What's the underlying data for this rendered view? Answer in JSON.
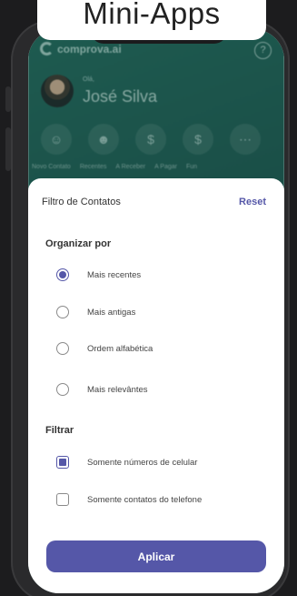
{
  "banner": {
    "title": "Mini-Apps"
  },
  "app": {
    "brand": "comprova.ai",
    "user_greeting": "Olá,",
    "user_name": "José Silva",
    "shortcuts": [
      {
        "icon": "user-icon",
        "label": "Novo Contato"
      },
      {
        "icon": "users-icon",
        "label": "Recentes"
      },
      {
        "icon": "receive-icon",
        "label": "A Receber"
      },
      {
        "icon": "pay-icon",
        "label": "A Pagar"
      },
      {
        "icon": "more-icon",
        "label": "Fun"
      }
    ]
  },
  "sheet": {
    "title": "Filtro de Contatos",
    "reset_label": "Reset",
    "sort_title": "Organizar por",
    "sort_options": [
      {
        "label": "Mais recentes",
        "checked": true
      },
      {
        "label": "Mais antigas",
        "checked": false
      },
      {
        "label": "Ordem alfabética",
        "checked": false
      },
      {
        "label": "Mais relevântes",
        "checked": false
      }
    ],
    "filter_title": "Filtrar",
    "filter_options": [
      {
        "label": "Somente números de celular",
        "checked": true
      },
      {
        "label": "Somente contatos do telefone",
        "checked": false
      }
    ],
    "apply_label": "Aplicar"
  },
  "colors": {
    "accent": "#5557a8",
    "app_bg": "#1a4e47"
  }
}
